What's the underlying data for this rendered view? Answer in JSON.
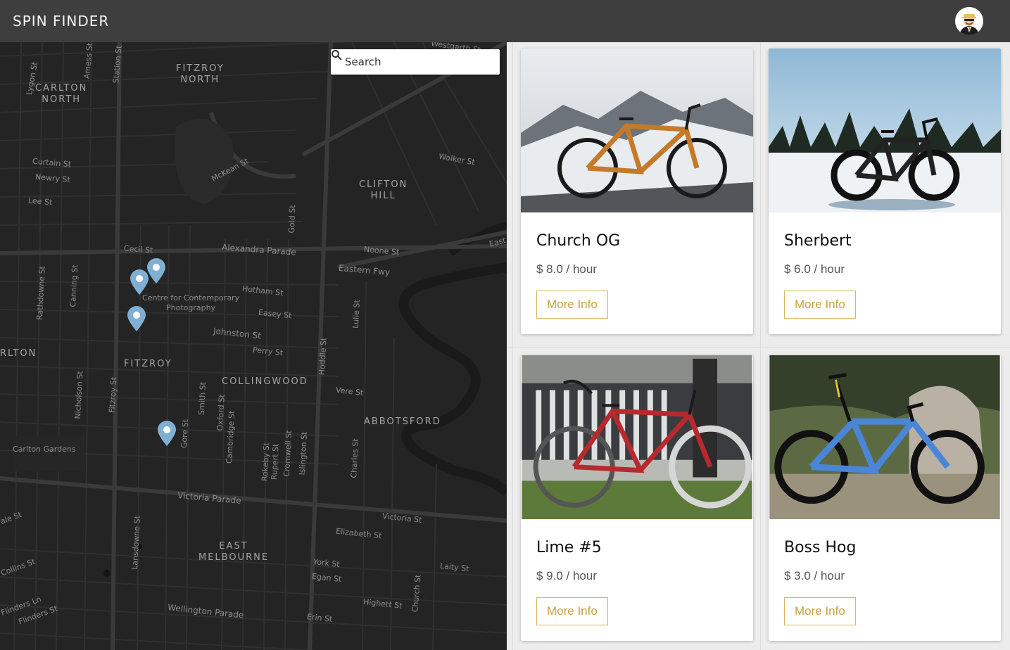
{
  "header": {
    "title": "SPIN FINDER",
    "avatar_icon": "user-avatar-icon"
  },
  "map": {
    "search_placeholder": "Search",
    "suburbs": [
      {
        "id": "fitzroy-north",
        "text": "FITZROY\nNORTH"
      },
      {
        "id": "carlton-north",
        "text": "CARLTON\nNORTH"
      },
      {
        "id": "clifton-hill",
        "text": "CLIFTON\nHILL"
      },
      {
        "id": "fitzroy",
        "text": "FITZROY"
      },
      {
        "id": "collingwood",
        "text": "COLLINGWOOD"
      },
      {
        "id": "abbotsford",
        "text": "ABBOTSFORD"
      },
      {
        "id": "east-melbourne",
        "text": "EAST\nMELBOURNE"
      },
      {
        "id": "carlton",
        "text": "RLTON"
      }
    ],
    "streets": [
      "Lygon St",
      "Amess St",
      "Station St",
      "Curtain St",
      "Newry St",
      "Lee St",
      "McKean St",
      "Walker St",
      "Gold St",
      "Cecil St",
      "Alexandra Parade",
      "Noone St",
      "Eastern Fwy",
      "Rathdowne St",
      "Canning St",
      "Hotham St",
      "Easey St",
      "Johnston St",
      "Perry St",
      "Lulie St",
      "Hoddle St",
      "Vere St",
      "Nicholson St",
      "Fitzroy St",
      "Smith St",
      "Oxford St",
      "Cambridge St",
      "Gore St",
      "Rokeby St",
      "Rupert St",
      "Cromwell St",
      "Islington St",
      "Charles St",
      "Carlton Gardens",
      "Victoria Parade",
      "Victoria St",
      "Lansdowne St",
      "Elizabeth St",
      "York St",
      "Egan St",
      "Laity St",
      "Highett St",
      "Church St",
      "Wellington Parade",
      "Erin St",
      "Flinders Ln",
      "Flinders St",
      "Collins St",
      "ale St",
      "Westgarth St",
      "East",
      "Centre for Contemporary\nPhotography"
    ]
  },
  "listings": [
    {
      "name": "Church OG",
      "price": "$ 8.0 / hour",
      "button": "More Info",
      "photo": "orange-gravel-bike-in-snow"
    },
    {
      "name": "Sherbert",
      "price": "$ 6.0 / hour",
      "button": "More Info",
      "photo": "black-fat-bike-on-frozen-lake"
    },
    {
      "name": "Lime #5",
      "price": "$ 9.0 / hour",
      "button": "More Info",
      "photo": "red-white-road-bike-by-fence"
    },
    {
      "name": "Boss Hog",
      "price": "$ 3.0 / hour",
      "button": "More Info",
      "photo": "blue-mountain-bike-by-rock"
    }
  ],
  "colors": {
    "accent": "#c9a13f",
    "topbar": "#3e3e3e",
    "map_bg": "#242424",
    "pin": "#7fb0d3"
  }
}
